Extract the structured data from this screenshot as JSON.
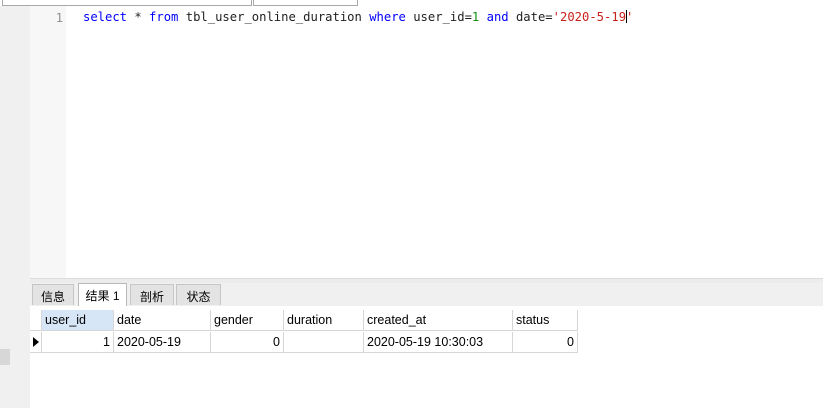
{
  "editor": {
    "line_number": "1",
    "tokens": {
      "select_kw": "select",
      "star": " * ",
      "from_kw": "from",
      "table": " tbl_user_online_duration ",
      "where_kw": "where",
      "col1": " user_id=",
      "val1": "1",
      "and_kw": " and",
      "col2": " date=",
      "str_part1": "'2020-5-19",
      "str_part2": "'"
    }
  },
  "tabs": [
    {
      "label": "信息"
    },
    {
      "label": "结果 1"
    },
    {
      "label": "剖析"
    },
    {
      "label": "状态"
    }
  ],
  "grid": {
    "columns": [
      "user_id",
      "date",
      "gender",
      "duration",
      "created_at",
      "status"
    ],
    "rows": [
      {
        "user_id": "1",
        "date": "2020-05-19",
        "gender": "0",
        "duration": "",
        "created_at": "2020-05-19 10:30:03",
        "status": "0"
      }
    ]
  },
  "colors": {
    "keyword": "#0000ff",
    "number": "#0f8f0f",
    "string": "#c8221b",
    "selected_header": "#d7e6f7"
  }
}
